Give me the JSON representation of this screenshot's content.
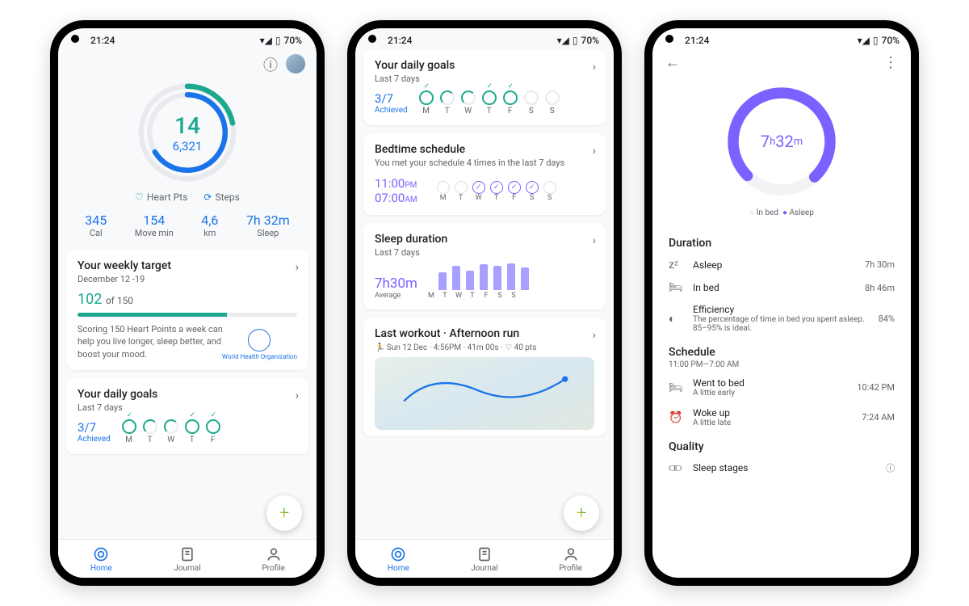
{
  "status": {
    "time": "21:24",
    "battery": "70%"
  },
  "p1": {
    "ring": {
      "heart_pts": "14",
      "steps": "6,321"
    },
    "legend": {
      "hp": "Heart Pts",
      "st": "Steps"
    },
    "metrics": [
      {
        "v": "345",
        "l": "Cal"
      },
      {
        "v": "154",
        "l": "Move min"
      },
      {
        "v": "4,6",
        "l": "km"
      },
      {
        "v": "7h 32m",
        "l": "Sleep"
      }
    ],
    "weekly": {
      "title": "Your weekly target",
      "date": "December 12 -19",
      "value": "102",
      "of": "of 150",
      "pct": 68,
      "desc": "Scoring 150 Heart Points a week can help you live longer, sleep better, and boost your mood.",
      "who": "World Health Organization"
    },
    "daily": {
      "title": "Your daily goals",
      "sub": "Last 7 days",
      "achieved": "3/7",
      "achieved_l": "Achieved",
      "days": [
        "M",
        "T",
        "W",
        "T",
        "F"
      ]
    },
    "nav": {
      "home": "Home",
      "journal": "Journal",
      "profile": "Profile"
    }
  },
  "p2": {
    "daily": {
      "title": "Your daily goals",
      "sub": "Last 7 days",
      "achieved": "3/7",
      "achieved_l": "Achieved",
      "days": [
        "M",
        "T",
        "W",
        "T",
        "F",
        "S",
        "S"
      ]
    },
    "bed": {
      "title": "Bedtime schedule",
      "sub": "You met your schedule 4 times in the last 7 days",
      "t1": "11:00",
      "t1p": "PM",
      "t2": "07:00",
      "t2p": "AM",
      "days": [
        "M",
        "T",
        "W",
        "T",
        "F",
        "S",
        "S"
      ],
      "met": [
        false,
        false,
        true,
        true,
        true,
        true,
        false
      ]
    },
    "sleep": {
      "title": "Sleep duration",
      "sub": "Last 7 days",
      "avg": "7h30m",
      "avg_l": "Average",
      "bars": [
        22,
        30,
        24,
        32,
        30,
        33,
        28
      ],
      "days": [
        "M",
        "T",
        "W",
        "T",
        "F",
        "S",
        "S"
      ]
    },
    "workout": {
      "title": "Last workout · Afternoon run",
      "meta": "🏃 Sun 12 Dec · 4:56PM · 41m 00s · ♡ 40 pts"
    }
  },
  "p3": {
    "time": "7h 32m",
    "leg_inbed": "In bed",
    "leg_asleep": "Asleep",
    "duration": {
      "h": "Duration",
      "rows": [
        {
          "ic": "zᶻ",
          "l": "Asleep",
          "v": "7h 30m"
        },
        {
          "ic": "🛏",
          "l": "In bed",
          "v": "8h 46m"
        },
        {
          "ic": "◐",
          "l": "Efficiency",
          "d": "The percentage of time in bed you spent asleep. 85–95% is ideal.",
          "v": "84%"
        }
      ]
    },
    "schedule": {
      "h": "Schedule",
      "sub": "11:00 PM—7:00 AM",
      "rows": [
        {
          "ic": "🛏",
          "l": "Went to bed",
          "d": "A little early",
          "v": "10:42 PM"
        },
        {
          "ic": "⏰",
          "l": "Woke up",
          "d": "A little late",
          "v": "7:24 AM"
        }
      ]
    },
    "quality": {
      "h": "Quality",
      "row": {
        "ic": "▮▮",
        "l": "Sleep stages"
      }
    }
  }
}
